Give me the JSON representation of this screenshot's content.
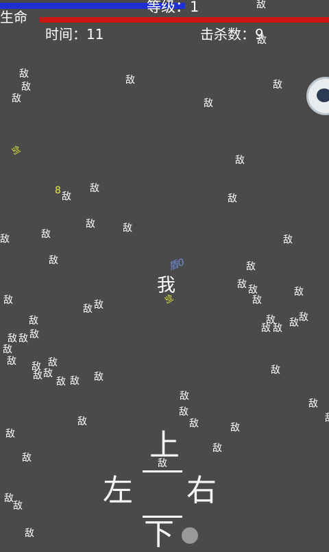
{
  "hud": {
    "level_text": "等级：1",
    "life_label": "生命",
    "time_text": "时间：11",
    "kills_text": "击杀数：9"
  },
  "player_glyph": "我",
  "enemy_glyph": "敌",
  "weapon_glyph": "剑",
  "bonus_text": "8",
  "shield_text": "盾0",
  "controls": {
    "up": "上",
    "down": "下",
    "left": "左",
    "right": "右"
  },
  "colors": {
    "background": "#4a4a4a",
    "xp_bar": "#1f2fd6",
    "hp_bar": "#d01515",
    "weapon": "#e3ec3a"
  }
}
